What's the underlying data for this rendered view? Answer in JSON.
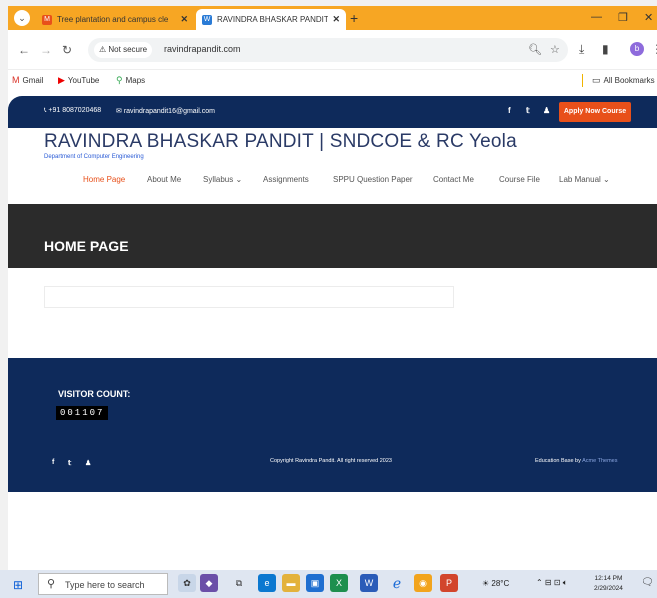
{
  "browser": {
    "tabs": [
      {
        "title": "Tree plantation and campus cle",
        "active": false
      },
      {
        "title": "RAVINDRA BHASKAR PANDIT |",
        "active": true
      }
    ],
    "address": {
      "security_label": "Not secure",
      "url": "ravindrapandit.com"
    },
    "bookmarks": [
      {
        "label": "Gmail",
        "icon": "gmail-icon"
      },
      {
        "label": "YouTube",
        "icon": "youtube-icon"
      },
      {
        "label": "Maps",
        "icon": "maps-icon"
      }
    ],
    "all_bookmarks": "All Bookmarks",
    "profile_initial": "b"
  },
  "site": {
    "phone": "+91 8087020468",
    "email": "ravindrapandit16@gmail.com",
    "apply_button": "Apply Now Course",
    "title": "RAVINDRA BHASKAR PANDIT | SNDCOE & RC Yeola",
    "subtitle": "Department of Computer Engineering",
    "nav": [
      {
        "label": "Home Page",
        "active": true
      },
      {
        "label": "About Me"
      },
      {
        "label": "Syllabus ⌄"
      },
      {
        "label": "Assignments"
      },
      {
        "label": "SPPU Question Paper"
      },
      {
        "label": "Contact Me"
      },
      {
        "label": "Course File"
      },
      {
        "label": "Lab Manual ⌄"
      }
    ],
    "hero_title": "HOME PAGE",
    "visitor_label": "VISITOR COUNT:",
    "visitor_count": "001107",
    "copyright": "Copyright Ravindra Pandit. All right reserved 2023",
    "theme_prefix": "Education Base by",
    "theme_link": "Acme Themes",
    "colors": {
      "navy": "#0e2a5b",
      "accent": "#e8501a",
      "hero": "#2b2b2b"
    }
  },
  "taskbar": {
    "search_placeholder": "Type here to search",
    "weather": "28°C",
    "time": "12:14 PM",
    "date": "2/29/2024"
  }
}
